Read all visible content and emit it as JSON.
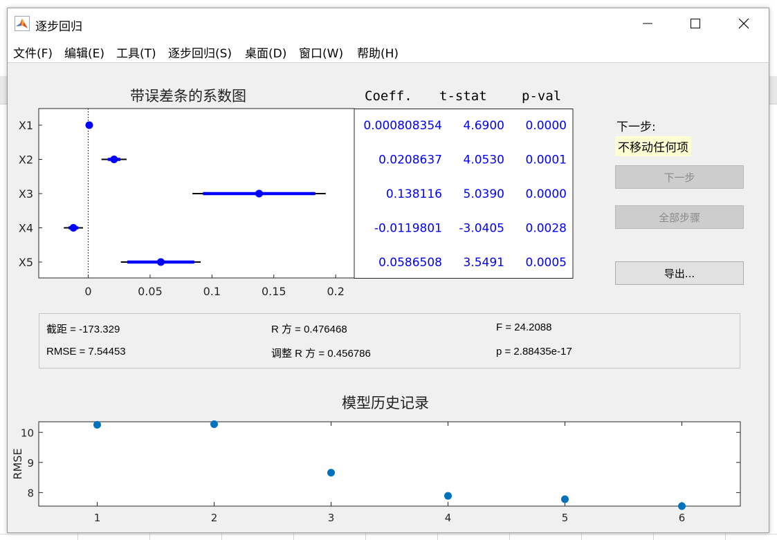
{
  "window": {
    "title": "逐步回归"
  },
  "menu": [
    "文件(F)",
    "编辑(E)",
    "工具(T)",
    "逐步回归(S)",
    "桌面(D)",
    "窗口(W)",
    "帮助(H)"
  ],
  "coef_plot": {
    "title": "带误差条的系数图",
    "table_headers": [
      "Coeff.",
      "t-stat",
      "p-val"
    ],
    "accent_color": "#0000ff",
    "terms": [
      {
        "name": "X1",
        "coeff": "0.000808354",
        "tstat": "4.6900",
        "pval": "0.0000",
        "est": 0.000808,
        "ci68": [
          0.00064,
          0.00098
        ],
        "ci95": [
          0.00047,
          0.00115
        ]
      },
      {
        "name": "X2",
        "coeff": "0.0208637",
        "tstat": "4.0530",
        "pval": "0.0001",
        "est": 0.02086,
        "ci68": [
          0.0158,
          0.026
        ],
        "ci95": [
          0.0107,
          0.031
        ]
      },
      {
        "name": "X3",
        "coeff": "0.138116",
        "tstat": "5.0390",
        "pval": "0.0000",
        "est": 0.1381,
        "ci68": [
          0.0927,
          0.1835
        ],
        "ci95": [
          0.0842,
          0.192
        ]
      },
      {
        "name": "X4",
        "coeff": "-0.0119801",
        "tstat": "-3.0405",
        "pval": "0.0028",
        "est": -0.01198,
        "ci68": [
          -0.0159,
          -0.0081
        ],
        "ci95": [
          -0.0197,
          -0.0042
        ]
      },
      {
        "name": "X5",
        "coeff": "0.0586508",
        "tstat": "3.5491",
        "pval": "0.0005",
        "est": 0.05865,
        "ci68": [
          0.0316,
          0.0857
        ],
        "ci95": [
          0.0264,
          0.0909
        ]
      }
    ],
    "x_ticks": [
      "0",
      "0.05",
      "0.1",
      "0.15",
      "0.2"
    ],
    "x_tick_values": [
      0,
      0.05,
      0.1,
      0.15,
      0.2
    ],
    "xlim": [
      -0.04,
      0.215
    ]
  },
  "side": {
    "next_step_label": "下一步:",
    "next_step_value": "不移动任何项",
    "next_button": "下一步",
    "all_steps_button": "全部步骤",
    "export_button": "导出..."
  },
  "stats": {
    "intercept": "截距 = -173.329",
    "rsq": "R 方 = 0.476468",
    "f": "F = 24.2088",
    "rmse": "RMSE = 7.54453",
    "adj_rsq": "调整 R 方 = 0.456786",
    "p": "p = 2.88435e-17"
  },
  "chart_data": {
    "type": "scatter",
    "title": "模型历史记录",
    "xlabel": "",
    "ylabel": "RMSE",
    "x": [
      1,
      2,
      3,
      4,
      5,
      6
    ],
    "values": [
      10.25,
      10.27,
      8.66,
      7.89,
      7.78,
      7.55
    ],
    "xlim": [
      0.5,
      6.5
    ],
    "ylim": [
      7.55,
      10.35
    ],
    "x_ticks": [
      1,
      2,
      3,
      4,
      5,
      6
    ],
    "y_ticks": [
      8,
      9,
      10
    ],
    "color": "#0072bd"
  }
}
